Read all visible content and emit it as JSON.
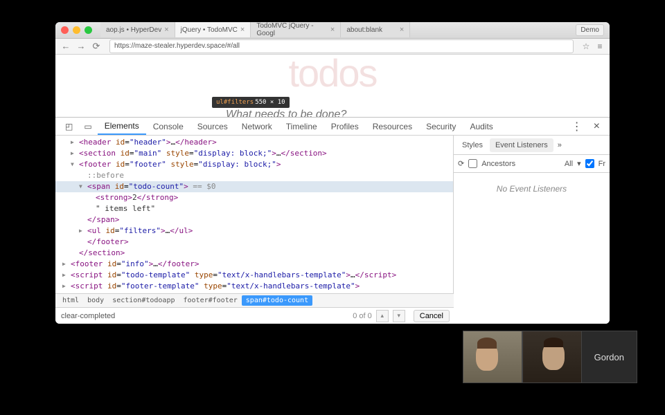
{
  "browser": {
    "tabs": [
      {
        "label": "aop.js • HyperDev"
      },
      {
        "label": "jQuery • TodoMVC"
      },
      {
        "label": "TodoMVC jQuery - Googl"
      },
      {
        "label": "about:blank"
      }
    ],
    "demo_label": "Demo",
    "url": "https://maze-stealer.hyperdev.space/#/all"
  },
  "page": {
    "title": "todos",
    "placeholder": "What needs to be done?",
    "tooltip_selector": "ul#filters",
    "tooltip_dims": "550 × 10"
  },
  "devtools": {
    "tabs": [
      "Elements",
      "Console",
      "Sources",
      "Network",
      "Timeline",
      "Profiles",
      "Resources",
      "Security",
      "Audits"
    ],
    "active_tab": "Elements",
    "sidebar": {
      "tabs": [
        "Styles",
        "Event Listeners"
      ],
      "active": "Event Listeners",
      "ancestors_label": "Ancestors",
      "filter": "All",
      "fr_label": "Fr",
      "empty": "No Event Listeners"
    },
    "tree": {
      "header_id": "header",
      "main_id": "main",
      "main_style": "display: block;",
      "footer_id": "footer",
      "footer_style": "display: block;",
      "before": "::before",
      "todo_count_id": "todo-count",
      "var_annotation": "== $0",
      "count_value": "2",
      "items_left": "\" items left\"",
      "span_close": "</span>",
      "filters_id": "filters",
      "footer_close": "</footer>",
      "section_close": "</section>",
      "info_id": "info",
      "tpl1_id": "todo-template",
      "tpl1_type": "text/x-handlebars-template",
      "tpl2_id": "footer-template",
      "tpl2_type": "text/x-handlebars-template"
    },
    "breadcrumb": [
      "html",
      "body",
      "section#todoapp",
      "footer#footer",
      "span#todo-count"
    ],
    "search": {
      "value": "clear-completed",
      "count": "0 of 0",
      "cancel": "Cancel"
    }
  },
  "video": {
    "name": "Gordon"
  }
}
